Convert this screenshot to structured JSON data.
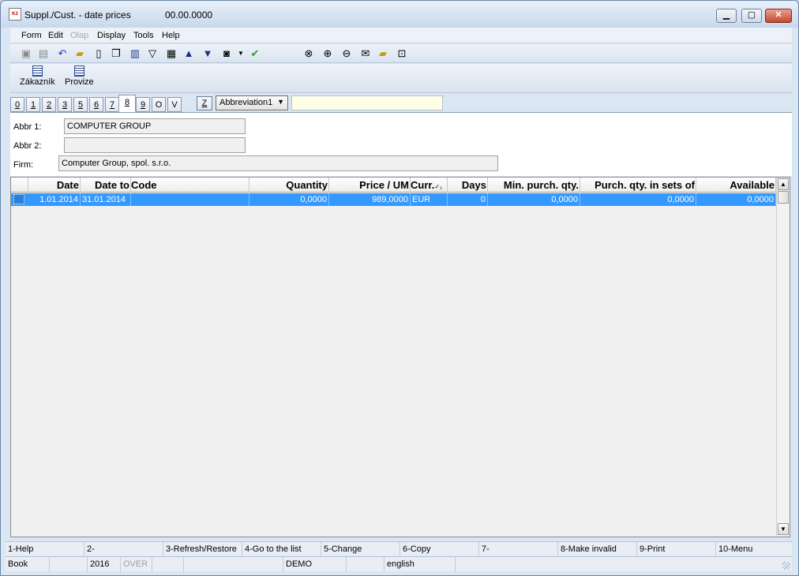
{
  "window": {
    "title": "Suppl./Cust. - date prices",
    "date": "00.00.0000",
    "icon_label": "K2",
    "controls": [
      "minimize-icon",
      "maximize-icon",
      "close-icon"
    ]
  },
  "menu": {
    "items": [
      "Form",
      "Edit",
      "Olap",
      "Display",
      "Tools",
      "Help"
    ]
  },
  "toolbar": {
    "icons": [
      "save-icon",
      "save-all-icon",
      "undo-icon",
      "open-folder-icon",
      "new-document-icon",
      "copy-icon",
      "book-icon",
      "filter-icon",
      "filter-list-icon",
      "arrow-up-icon",
      "arrow-down-icon",
      "camera-icon",
      "dropdown-arrow-icon",
      "check-run-icon",
      "binoculars-icon",
      "binoculars-next-icon",
      "binoculars-prev-icon",
      "mail-icon",
      "folder-edit-icon",
      "attachment-icon"
    ]
  },
  "bigbar": {
    "buttons": [
      "Zákazník",
      "Provize"
    ]
  },
  "tabs": {
    "labels": [
      "0",
      "1",
      "2",
      "3",
      "5",
      "6",
      "7",
      "8",
      "9",
      "O",
      "V"
    ],
    "active": "8",
    "z_label": "Z",
    "select_value": "Abbreviation1",
    "search_value": ""
  },
  "form": {
    "abbr1_label": "Abbr 1:",
    "abbr1_value": "COMPUTER GROUP",
    "abbr2_label": "Abbr 2:",
    "abbr2_value": "",
    "firm_label": "Firm:",
    "firm_value": "Computer Group, spol. s.r.o."
  },
  "grid": {
    "columns": [
      "Date",
      "Date to",
      "Code",
      "Quantity",
      "Price / UM",
      "Curr.",
      "Days",
      "Min. purch. qty.",
      "Purch. qty. in sets of",
      "Available"
    ],
    "rows": [
      {
        "date": "1.01.2014",
        "date_to": "31.01.2014",
        "code": "",
        "quantity": "0,0000",
        "price": "989,0000",
        "curr": "EUR",
        "days": "0",
        "min_qty": "0,0000",
        "sets_of": "0,0000",
        "available": "0,0000"
      }
    ]
  },
  "fkeys": [
    "1-Help",
    "2-",
    "3-Refresh/Restore",
    "4-Go to the list",
    "5-Change",
    "6-Copy",
    "7-",
    "8-Make invalid",
    "9-Print",
    "10-Menu"
  ],
  "status": {
    "book": "Book",
    "year": "2016",
    "mode": "OVER",
    "db": "DEMO",
    "language": "english"
  }
}
